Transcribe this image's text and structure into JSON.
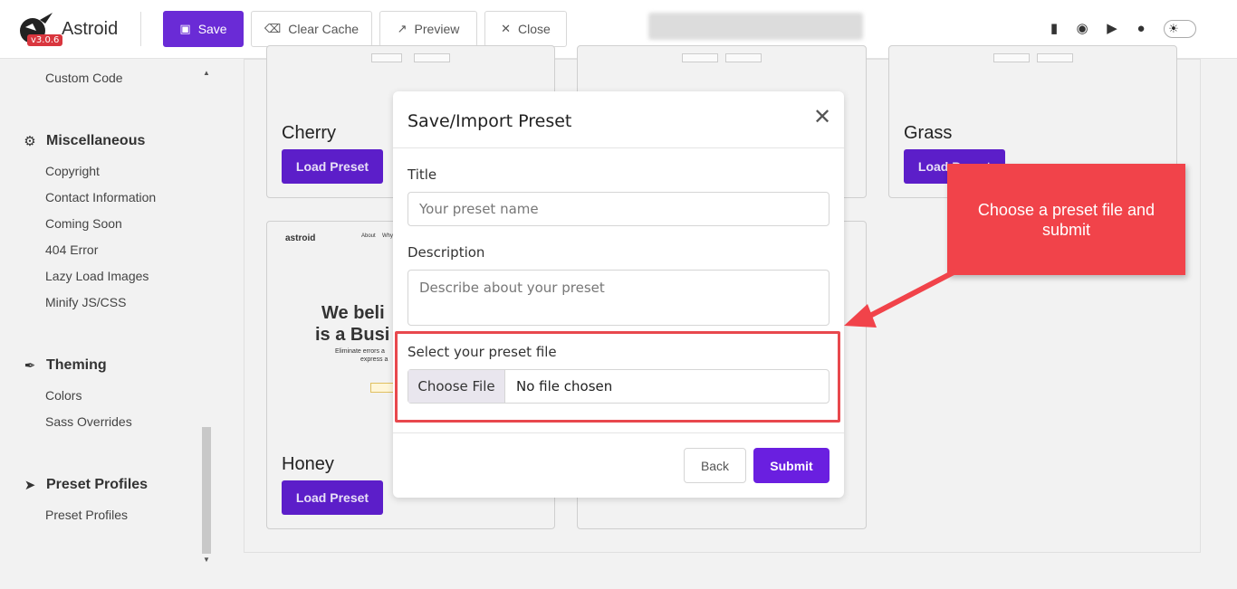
{
  "header": {
    "brand": "Astroid",
    "version": "v3.0.6",
    "buttons": {
      "save": "Save",
      "clear_cache": "Clear Cache",
      "preview": "Preview",
      "close": "Close"
    },
    "icons": [
      "book-icon",
      "github-icon",
      "youtube-icon",
      "astroid-icon",
      "theme-toggle-icon"
    ]
  },
  "sidebar": {
    "top_item": "Custom Code",
    "sections": [
      {
        "title": "Miscellaneous",
        "icon": "gears-icon",
        "items": [
          "Copyright",
          "Contact Information",
          "Coming Soon",
          "404 Error",
          "Lazy Load Images",
          "Minify JS/CSS"
        ]
      },
      {
        "title": "Theming",
        "icon": "brush-icon",
        "items": [
          "Colors",
          "Sass Overrides"
        ]
      },
      {
        "title": "Preset Profiles",
        "icon": "rocket-icon",
        "items": [
          "Preset Profiles"
        ]
      }
    ]
  },
  "presets": {
    "cards": [
      {
        "title": "Cherry",
        "button": "Load Preset"
      },
      {
        "title": "Grass",
        "button": "Load Preset"
      },
      {
        "title": "Honey",
        "button": "Load Preset"
      }
    ],
    "thumbnail": {
      "logo": "astroid",
      "nav1": "About",
      "nav2": "Why",
      "headline1": "We beli",
      "headline2": "is a Busi",
      "sub1": "Eliminate errors a",
      "sub2": "express a"
    }
  },
  "modal": {
    "title": "Save/Import Preset",
    "title_label": "Title",
    "title_placeholder": "Your preset name",
    "description_label": "Description",
    "description_placeholder": "Describe about your preset",
    "file_label": "Select your preset file",
    "file_button": "Choose File",
    "file_status": "No file chosen",
    "back": "Back",
    "submit": "Submit"
  },
  "annotation": {
    "callout_text": "Choose a preset file and submit",
    "color": "#f1434a"
  },
  "colors": {
    "primary": "#6a2bd6",
    "load_button": "#5c1ec9",
    "submit": "#6a1fe0"
  }
}
